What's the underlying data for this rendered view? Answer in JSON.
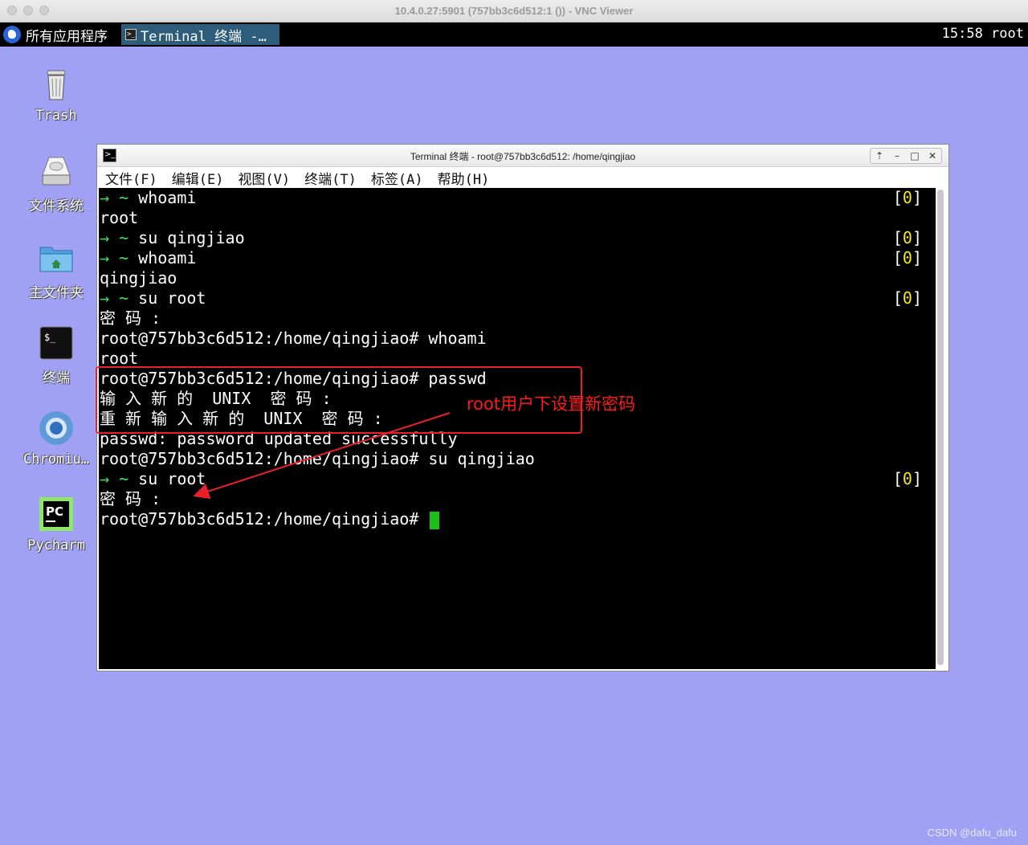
{
  "mac_window": {
    "title": "10.4.0.27:5901 (757bb3c6d512:1 ()) - VNC Viewer"
  },
  "panel": {
    "apps_menu": "所有应用程序",
    "task_label": "Terminal 终端 -…",
    "clock": "15:58 root"
  },
  "desktop_icons": [
    {
      "name": "trash",
      "label": "Trash",
      "icon": "trash-icon"
    },
    {
      "name": "filesystem",
      "label": "文件系统",
      "icon": "drive-icon"
    },
    {
      "name": "home-folder",
      "label": "主文件夹",
      "icon": "home-folder-icon"
    },
    {
      "name": "terminal",
      "label": "终端",
      "icon": "terminal-icon"
    },
    {
      "name": "chromium",
      "label": "Chromiu…",
      "icon": "chromium-icon"
    },
    {
      "name": "pycharm",
      "label": "Pycharm",
      "icon": "pycharm-icon"
    }
  ],
  "terminal": {
    "title": "Terminal 终端 - root@757bb3c6d512: /home/qingjiao",
    "menu": [
      "文件(F)",
      "编辑(E)",
      "视图(V)",
      "终端(T)",
      "标签(A)",
      "帮助(H)"
    ],
    "lines": [
      {
        "prompt": "→ ~ ",
        "text": "whoami",
        "exit": "0"
      },
      {
        "prompt": "",
        "text": "root",
        "exit": ""
      },
      {
        "prompt": "→ ~ ",
        "text": "su qingjiao",
        "exit": "0"
      },
      {
        "prompt": "→ ~ ",
        "text": "whoami",
        "exit": "0"
      },
      {
        "prompt": "",
        "text": "qingjiao",
        "exit": ""
      },
      {
        "prompt": "→ ~ ",
        "text": "su root",
        "exit": "0"
      },
      {
        "prompt": "",
        "text": "密 码 :",
        "exit": ""
      },
      {
        "prompt": "",
        "text": "root@757bb3c6d512:/home/qingjiao# whoami",
        "exit": ""
      },
      {
        "prompt": "",
        "text": "root",
        "exit": ""
      },
      {
        "prompt": "",
        "text": "root@757bb3c6d512:/home/qingjiao# passwd",
        "exit": ""
      },
      {
        "prompt": "",
        "text": "输 入 新 的  UNIX  密 码 :",
        "exit": ""
      },
      {
        "prompt": "",
        "text": "重 新 输 入 新 的  UNIX  密 码 :",
        "exit": ""
      },
      {
        "prompt": "",
        "text": "passwd: password updated successfully",
        "exit": ""
      },
      {
        "prompt": "",
        "text": "root@757bb3c6d512:/home/qingjiao# su qingjiao",
        "exit": ""
      },
      {
        "prompt": "→ ~ ",
        "text": "su root",
        "exit": "0"
      },
      {
        "prompt": "",
        "text": "密 码 :",
        "exit": ""
      },
      {
        "prompt": "",
        "text": "root@757bb3c6d512:/home/qingjiao# ",
        "exit": ""
      }
    ]
  },
  "annotation": {
    "text": "root用户下设置新密码",
    "color": "#e8202a"
  },
  "watermark": "CSDN @dafu_dafu"
}
